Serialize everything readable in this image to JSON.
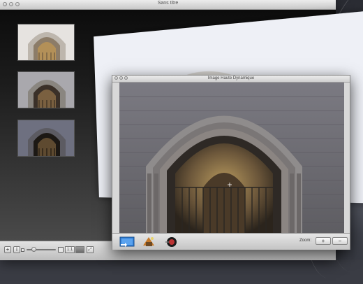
{
  "main_window": {
    "title": "Sans titre",
    "view_buttons": {
      "one": "1:1"
    }
  },
  "hdr_window": {
    "title": "Image Haute Dynamique",
    "zoom_label": "Zoom:",
    "zoom_in": "+",
    "zoom_out": "−"
  },
  "toolbar": {
    "add": "+",
    "info": "i",
    "slider_value": 0.2
  },
  "icons": {
    "add": "plus-icon",
    "info": "info-icon",
    "fullscreen": "fullscreen-icon",
    "export": "export-icon",
    "tonemap": "tonemap-icon",
    "color": "color-adjust-icon"
  }
}
